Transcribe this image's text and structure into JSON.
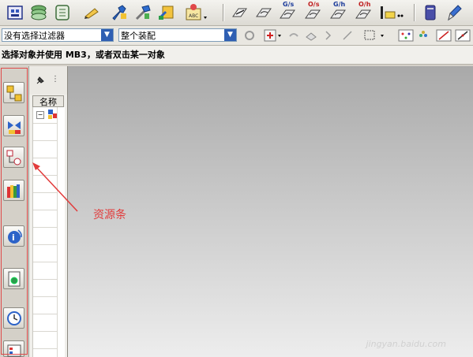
{
  "toolbar": {
    "icons": [
      "part-navigator-icon",
      "layer-icon",
      "assembly-icon",
      "pencil-icon",
      "wrench-icon",
      "hammer-icon",
      "tool-icon",
      "drafting-icon",
      "sketch-icon",
      "surface-icon",
      "gs-icon",
      "os-icon",
      "gh-icon",
      "oh-icon",
      "measure-icon",
      "database-icon",
      "pen-icon"
    ],
    "badges": {
      "gs": "G/s",
      "os": "O/s",
      "gh": "G/h",
      "oh": "O/h"
    }
  },
  "filter_bar": {
    "type_filter": "没有选择过滤器",
    "scope_filter": "整个装配"
  },
  "status_bar": {
    "prompt": "选择对象并使用 MB3，或者双击某一对象"
  },
  "navigator": {
    "column_header": "名称"
  },
  "annotation": {
    "label": "资源条",
    "color": "#e23b3b"
  },
  "watermark": "jingyan.baidu.com"
}
